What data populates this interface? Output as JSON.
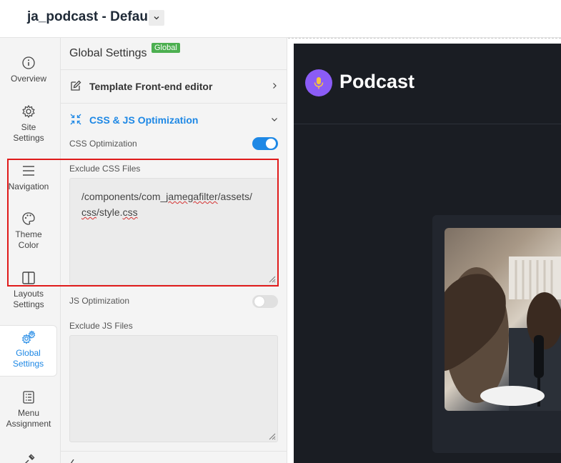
{
  "header": {
    "title": "ja_podcast - Default"
  },
  "sidebar": {
    "items": [
      {
        "label": "Overview",
        "icon": "info-icon"
      },
      {
        "label": "Site Settings",
        "icon": "gear-icon"
      },
      {
        "label": "Navigation",
        "icon": "menu-icon"
      },
      {
        "label": "Theme Color",
        "icon": "palette-icon"
      },
      {
        "label": "Layouts Settings",
        "icon": "layout-icon"
      },
      {
        "label": "Global Settings",
        "icon": "gears-icon",
        "active": true
      },
      {
        "label": "Menu Assignment",
        "icon": "list-icon"
      }
    ]
  },
  "panel": {
    "title": "Global Settings",
    "badge": "Global",
    "sections": {
      "template_editor": "Template Front-end editor",
      "css_js": "CSS & JS Optimization"
    },
    "css_optimization": {
      "label": "CSS Optimization",
      "enabled": true
    },
    "exclude_css": {
      "label": "Exclude CSS Files",
      "line1_a": "/components/com_",
      "line1_b": "jamegafilter",
      "line1_c": "/assets/",
      "line2_a": "css",
      "line2_b": "/style.",
      "line2_c": "css"
    },
    "js_optimization": {
      "label": "JS Optimization",
      "enabled": false
    },
    "exclude_js": {
      "label": "Exclude JS Files",
      "value": ""
    }
  },
  "preview": {
    "logo_text": "Podcast"
  },
  "colors": {
    "accent": "#1e88e5",
    "badge": "#4caf50",
    "highlight": "#e01b1b",
    "preview_bg": "#1a1d23",
    "logo": "#8b5cf6"
  }
}
